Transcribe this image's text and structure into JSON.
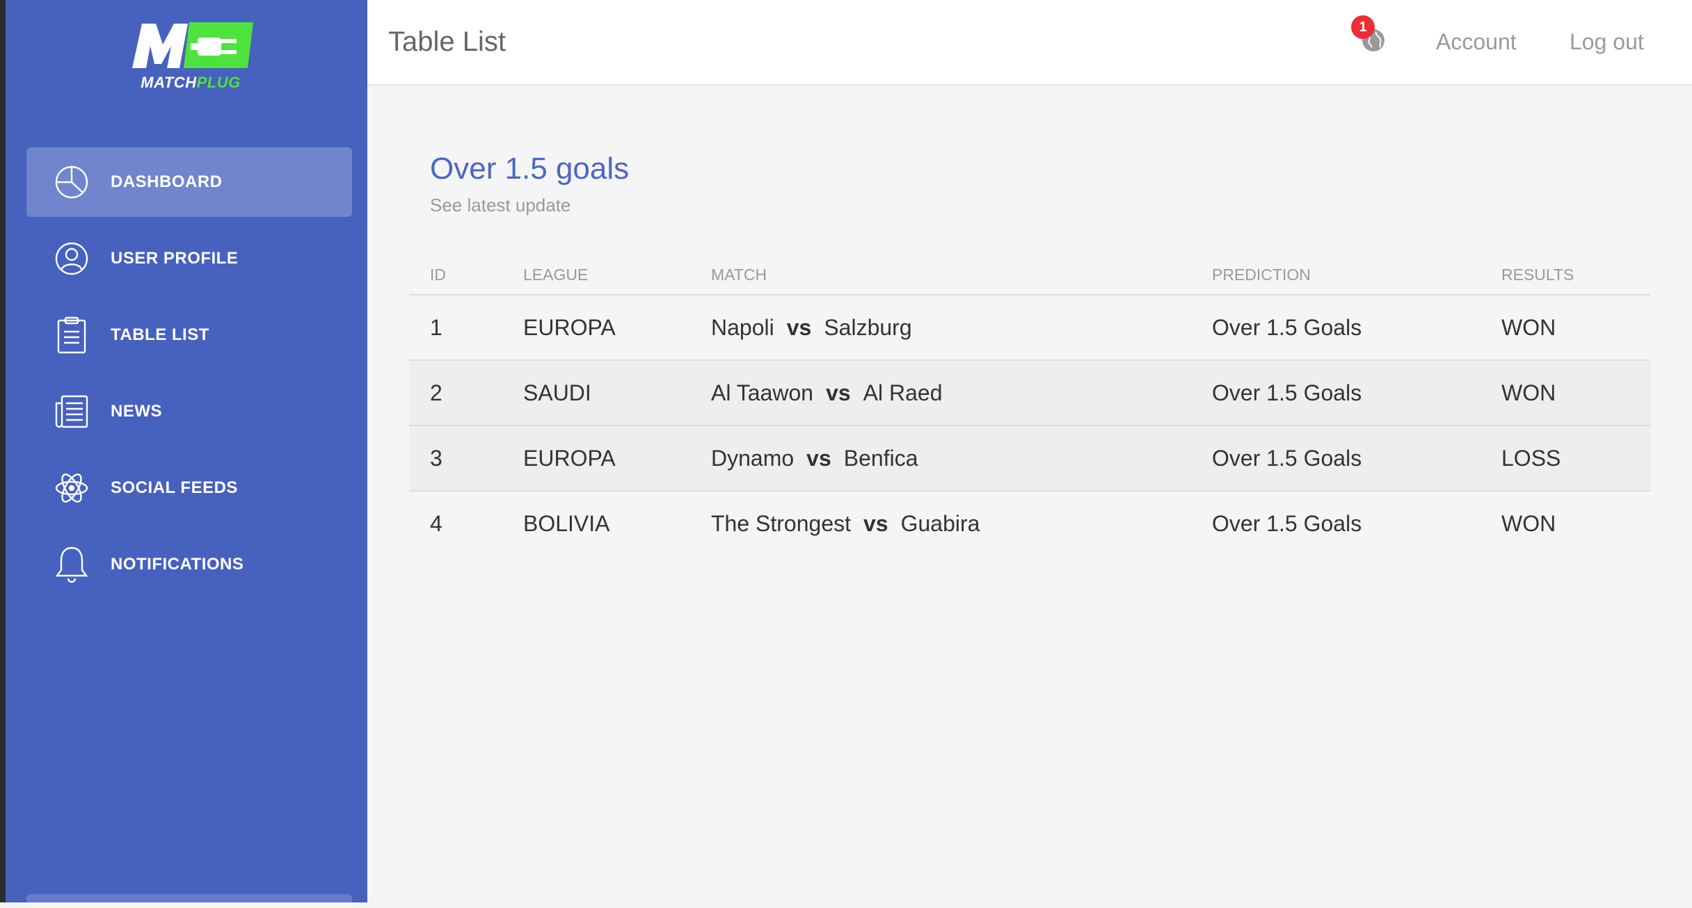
{
  "brand": {
    "mark": "M",
    "name_left": "MATCH",
    "name_right": "PLUG"
  },
  "colors": {
    "sidebar": "#4661be",
    "accent_green": "#4ee23c",
    "title_blue": "#4a67c3",
    "badge_red": "#ee2d35"
  },
  "sidebar": {
    "items": [
      {
        "label": "DASHBOARD",
        "icon": "pie-chart-icon",
        "active": true
      },
      {
        "label": "USER PROFILE",
        "icon": "user-icon",
        "active": false
      },
      {
        "label": "TABLE LIST",
        "icon": "clipboard-icon",
        "active": false
      },
      {
        "label": "NEWS",
        "icon": "newspaper-icon",
        "active": false
      },
      {
        "label": "SOCIAL FEEDS",
        "icon": "atom-icon",
        "active": false
      },
      {
        "label": "NOTIFICATIONS",
        "icon": "bell-icon",
        "active": false
      }
    ]
  },
  "header": {
    "title": "Table List",
    "notification_count": "1",
    "notification_icon": "globe-icon",
    "account_label": "Account",
    "logout_label": "Log out"
  },
  "card": {
    "title": "Over 1.5 goals",
    "subtitle": "See latest update",
    "columns": [
      "ID",
      "LEAGUE",
      "MATCH",
      "PREDICTION",
      "RESULTS"
    ],
    "vs_label": "vs",
    "rows": [
      {
        "id": "1",
        "league": "EUROPA",
        "home": "Napoli",
        "away": "Salzburg",
        "prediction": "Over 1.5 Goals",
        "result": "WON"
      },
      {
        "id": "2",
        "league": "SAUDI",
        "home": "Al Taawon",
        "away": "Al Raed",
        "prediction": "Over 1.5 Goals",
        "result": "WON"
      },
      {
        "id": "3",
        "league": "EUROPA",
        "home": "Dynamo",
        "away": "Benfica",
        "prediction": "Over 1.5 Goals",
        "result": "LOSS"
      },
      {
        "id": "4",
        "league": "BOLIVIA",
        "home": "The Strongest",
        "away": "Guabira",
        "prediction": "Over 1.5 Goals",
        "result": "WON"
      }
    ]
  }
}
